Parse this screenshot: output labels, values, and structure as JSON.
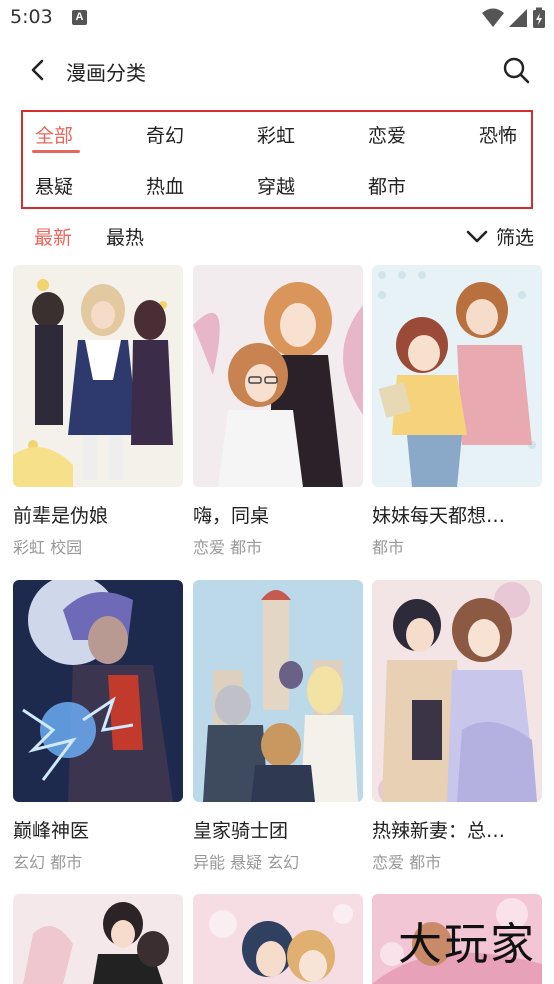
{
  "status_bar": {
    "time": "5:03",
    "notif_badge": "A"
  },
  "header": {
    "title": "漫画分类"
  },
  "categories": [
    "全部",
    "奇幻",
    "彩虹",
    "恋爱",
    "恐怖",
    "悬疑",
    "热血",
    "穿越",
    "都市"
  ],
  "sort": {
    "items": [
      "最新",
      "最热"
    ],
    "filter_label": "筛选"
  },
  "comics": [
    {
      "title": "前辈是伪娘",
      "tags": "彩虹 校园"
    },
    {
      "title": "嗨，同桌",
      "tags": "恋爱 都市"
    },
    {
      "title": "妹妹每天都想…",
      "tags": "都市"
    },
    {
      "title": "巅峰神医",
      "tags": "玄幻 都市"
    },
    {
      "title": "皇家骑士团",
      "tags": "异能 悬疑 玄幻"
    },
    {
      "title": "热辣新妻：总…",
      "tags": "恋爱 都市"
    }
  ],
  "watermark": "大玩家",
  "colors": {
    "accent": "#e8675c",
    "highlight_box": "#d32f2f",
    "tag_gray": "#999999"
  }
}
